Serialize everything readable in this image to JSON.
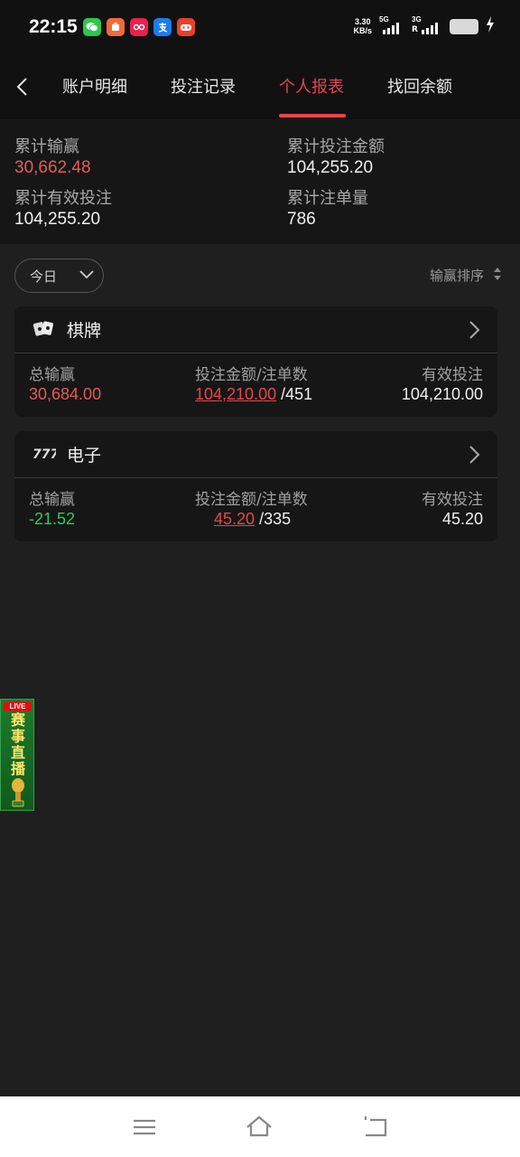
{
  "status_bar": {
    "time": "22:15",
    "net_speed_value": "3.30",
    "net_speed_unit": "KB/s",
    "sim1_label": "5G",
    "sim2_label": "3G",
    "roaming_label": "R",
    "app_icons": [
      "wechat-icon",
      "shopping-app-icon",
      "douyin-icon",
      "alipay-icon",
      "game-app-icon"
    ]
  },
  "nav": {
    "tabs": [
      {
        "label": "账户明细",
        "active": false
      },
      {
        "label": "投注记录",
        "active": false
      },
      {
        "label": "个人报表",
        "active": true
      },
      {
        "label": "找回余额",
        "active": false
      }
    ],
    "accent_color": "#e8454a"
  },
  "summary": {
    "total_winloss_label": "累计输赢",
    "total_winloss_value": "30,662.48",
    "total_bet_label": "累计投注金额",
    "total_bet_value": "104,255.20",
    "total_valid_label": "累计有效投注",
    "total_valid_value": "104,255.20",
    "total_orders_label": "累计注单量",
    "total_orders_value": "786"
  },
  "filter": {
    "date_selected": "今日",
    "sort_label": "输赢排序"
  },
  "cards": [
    {
      "title": "棋牌",
      "icon": "cards-icon",
      "winloss_label": "总输赢",
      "winloss_value": "30,684.00",
      "bet_label": "投注金额/注单数",
      "bet_amount": "104,210.00",
      "bet_count": "/451",
      "valid_label": "有效投注",
      "valid_value": "104,210.00"
    },
    {
      "title": "电子",
      "icon": "slot-777-icon",
      "winloss_label": "总输赢",
      "winloss_value": "-21.52",
      "bet_label": "投注金额/注单数",
      "bet_amount": "45.20",
      "bet_count": "/335",
      "valid_label": "有效投注",
      "valid_value": "45.20"
    }
  ],
  "live_widget": {
    "badge": "LIVE",
    "text": "赛事直播"
  }
}
